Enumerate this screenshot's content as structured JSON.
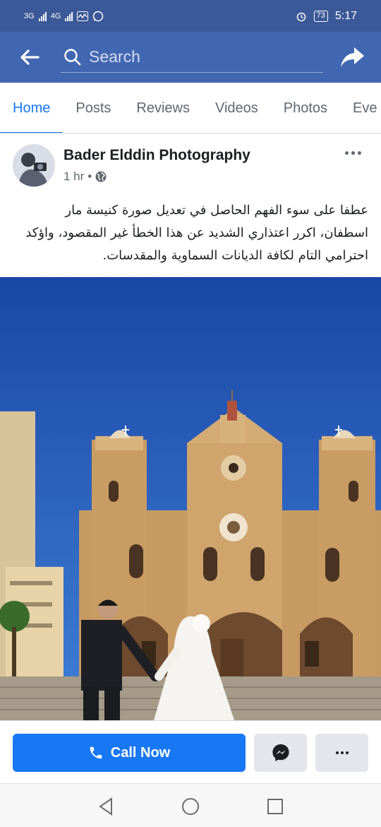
{
  "status_bar": {
    "network_1": "3G",
    "network_2": "4G",
    "battery": "73",
    "time": "5:17"
  },
  "topnav": {
    "search_placeholder": "Search"
  },
  "tabs": [
    {
      "label": "Home",
      "active": true
    },
    {
      "label": "Posts"
    },
    {
      "label": "Reviews"
    },
    {
      "label": "Videos"
    },
    {
      "label": "Photos"
    },
    {
      "label": "Eve"
    }
  ],
  "post": {
    "page_name": "Bader Elddin Photography",
    "time": "1 hr",
    "separator": "•",
    "text": "عطفا على سوء الفهم الحاصل في تعديل صورة كنيسة مار اسطفان، اكرر اعتذاري الشديد عن هذا الخطأ غير المقصود، واؤكد احترامي التام لكافة الديانات السماوية والمقدسات."
  },
  "actions": {
    "call_label": "Call Now"
  },
  "colors": {
    "brand_blue": "#4267b2",
    "status_blue": "#3b5998",
    "accent": "#1877f2"
  }
}
